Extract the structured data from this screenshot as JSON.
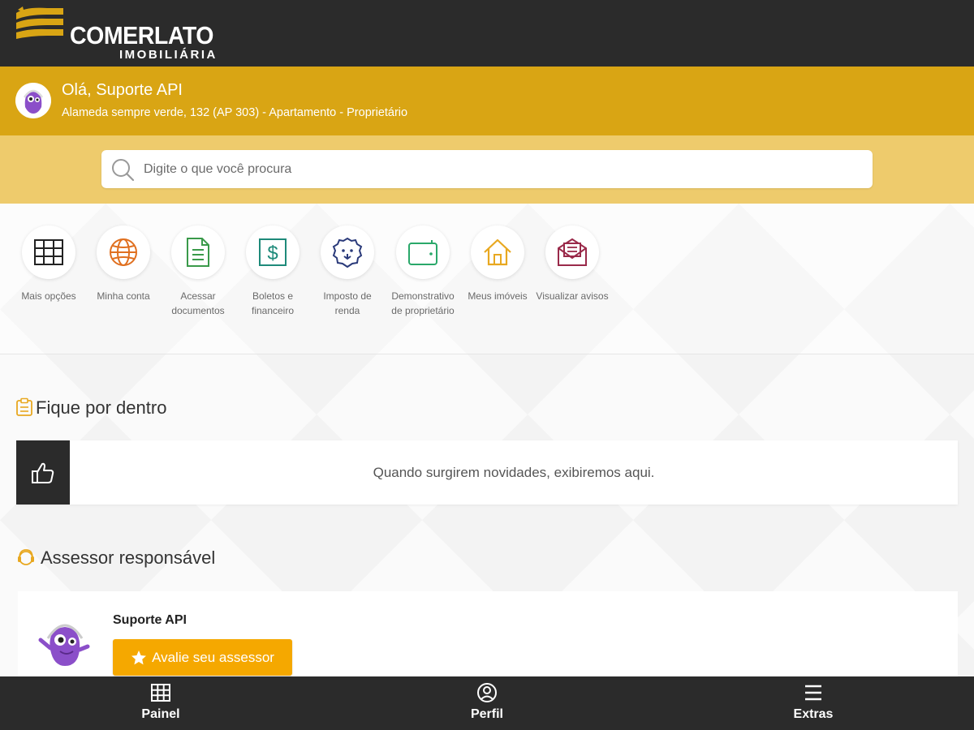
{
  "brand": {
    "name": "COMERLATO",
    "subtitle": "IMOBILIÁRIA",
    "accent": "#d9a514",
    "dark": "#2b2b2b"
  },
  "user": {
    "greeting": "Olá, Suporte API",
    "address": "Alameda sempre verde, 132 (AP 303) - Apartamento - Proprietário",
    "avatar_icon": "purple-monster-mascot-icon"
  },
  "search": {
    "placeholder": "Digite o que você procura"
  },
  "shortcuts": [
    {
      "label": "Mais opções",
      "icon": "grid-icon"
    },
    {
      "label": "Minha conta",
      "icon": "globe-icon"
    },
    {
      "label": "Acessar documentos",
      "icon": "document-icon"
    },
    {
      "label": "Boletos e financeiro",
      "icon": "dollar-icon"
    },
    {
      "label": "Imposto de renda",
      "icon": "lion-icon"
    },
    {
      "label": "Demonstrativo de proprietário",
      "icon": "wallet-icon"
    },
    {
      "label": "Meus imóveis",
      "icon": "house-icon"
    },
    {
      "label": "Visualizar avisos",
      "icon": "envelope-icon"
    }
  ],
  "news": {
    "title": "Fique por dentro",
    "empty_message": "Quando surgirem novidades, exibiremos aqui."
  },
  "advisor": {
    "title": "Assessor responsável",
    "name": "Suporte API",
    "rate_label": "Avalie seu assessor"
  },
  "bottom_nav": [
    {
      "label": "Painel",
      "icon": "grid-icon"
    },
    {
      "label": "Perfil",
      "icon": "user-circle-icon"
    },
    {
      "label": "Extras",
      "icon": "menu-icon"
    }
  ]
}
